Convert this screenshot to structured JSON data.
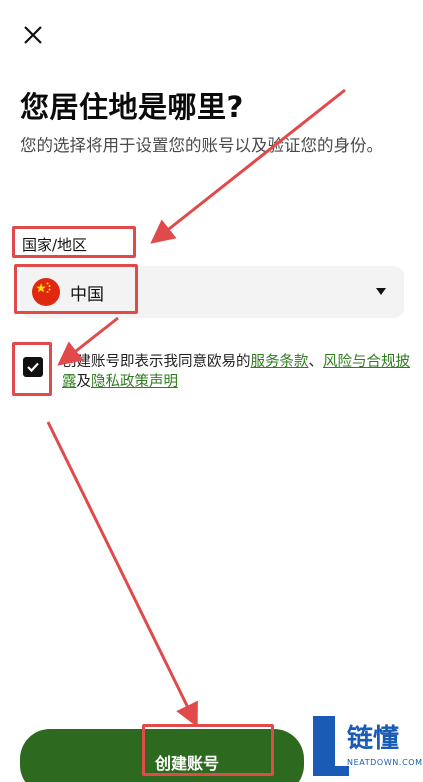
{
  "header": {
    "close_icon": "close-icon"
  },
  "title": "您居住地是哪里?",
  "subtitle": "您的选择将用于设置您的账号以及验证您的身份。",
  "country_field": {
    "label": "国家/地区",
    "value": "中国",
    "flag_icon": "china-flag-icon",
    "dropdown_icon": "caret-down-icon"
  },
  "agreement": {
    "checked": true,
    "prefix": "创建账号即表示我同意欧易的",
    "terms_link": "服务条款",
    "sep1": "、",
    "risk_link": "风险与合规披露",
    "sep2": "及",
    "privacy_link": "隐私政策声明"
  },
  "primary_button": {
    "label": "创建账号",
    "color": "#2d6a1f"
  },
  "watermark": {
    "name": "链懂",
    "site": "NEATDOWN.COM"
  },
  "annotation_color": "#e04a4a"
}
